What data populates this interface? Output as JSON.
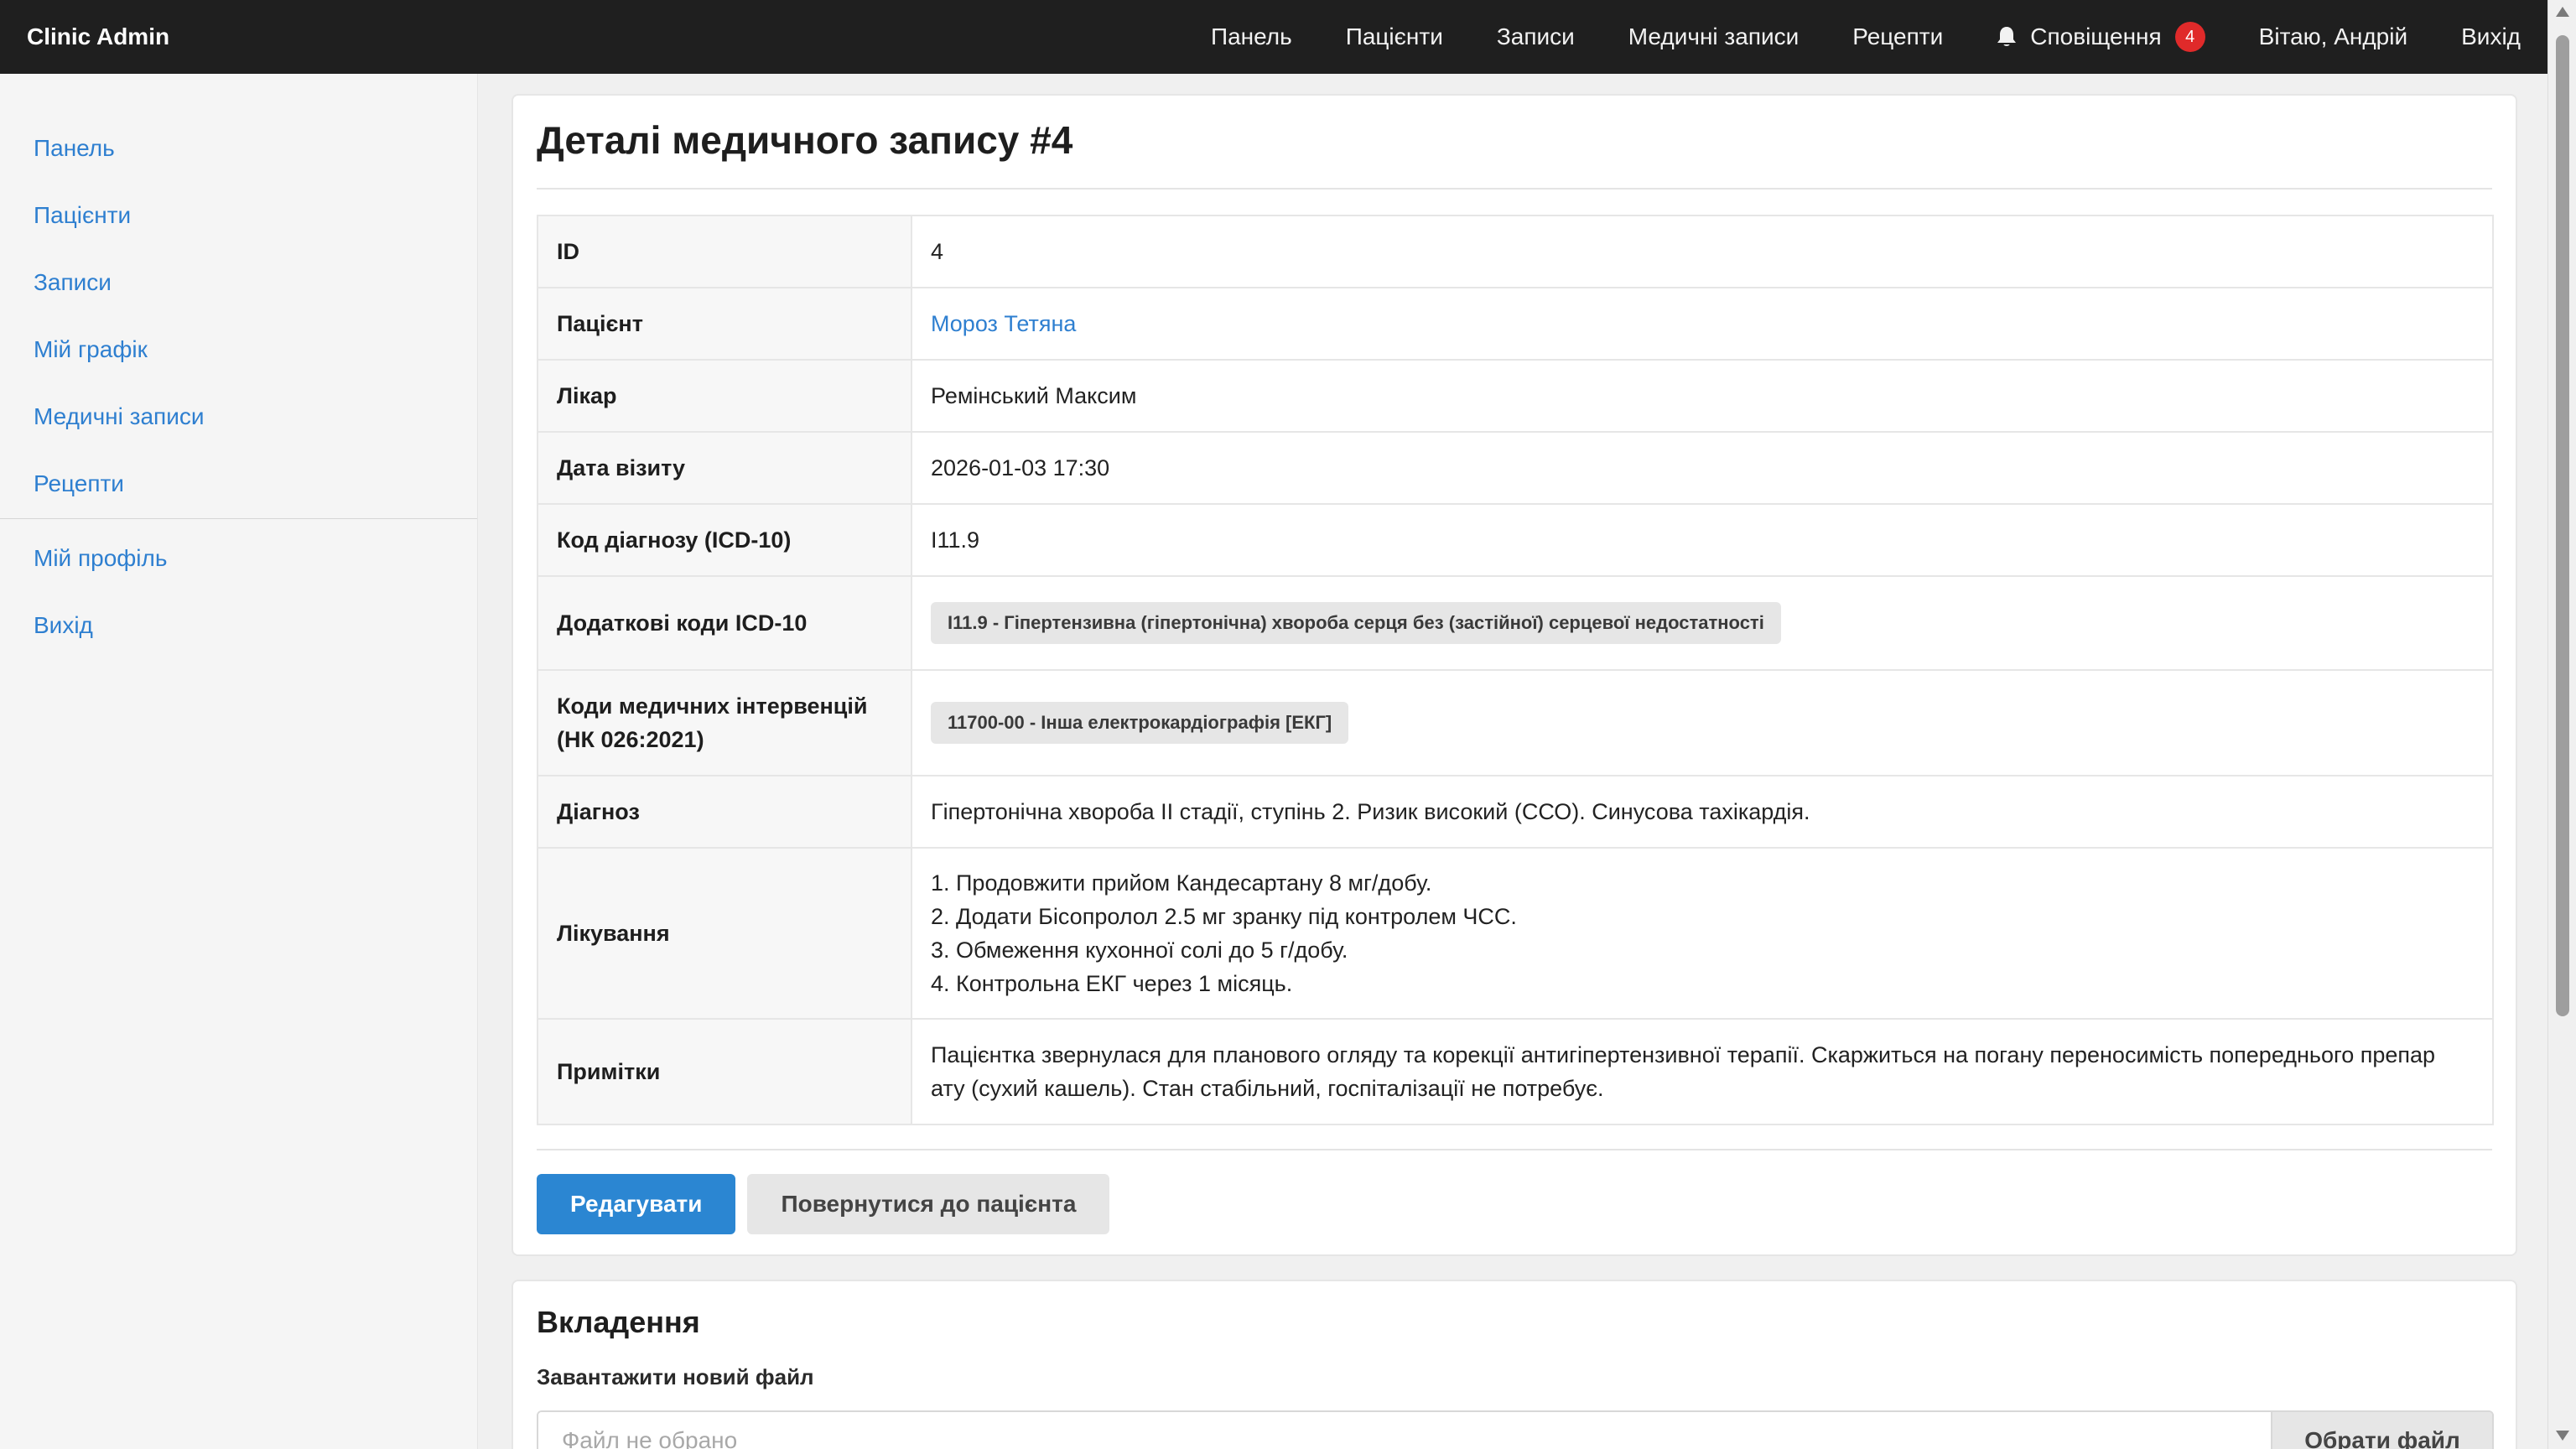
{
  "app": {
    "brand": "Clinic Admin"
  },
  "topnav": {
    "items": [
      "Панель",
      "Пацієнти",
      "Записи",
      "Медичні записи",
      "Рецепти"
    ],
    "notifications_label": "Сповіщення",
    "notifications_count": "4",
    "greeting": "Вітаю, Андрій",
    "logout": "Вихід"
  },
  "sidebar": {
    "items": [
      "Панель",
      "Пацієнти",
      "Записи",
      "Мій графік",
      "Медичні записи",
      "Рецепти"
    ],
    "profile": "Мій профіль",
    "logout": "Вихід"
  },
  "record": {
    "title": "Деталі медичного запису #4",
    "labels": {
      "id": "ID",
      "patient": "Пацієнт",
      "doctor": "Лікар",
      "visit_date": "Дата візиту",
      "diagnosis_code": "Код діагнозу (ICD-10)",
      "extra_codes": "Додаткові коди ICD-10",
      "interventions_1": "Коди медичних інтервенцій",
      "interventions_2": "(НК 026:2021)",
      "diagnosis": "Діагноз",
      "treatment": "Лікування",
      "notes": "Примітки"
    },
    "values": {
      "id": "4",
      "patient": "Мороз Тетяна",
      "doctor": "Ремінський Максим",
      "visit_date": "2026-01-03 17:30",
      "diagnosis_code": "I11.9",
      "extra_codes": [
        "I11.9 - Гіпертензивна (гіпертонічна) хвороба серця без (застійної) серцевої недостатності"
      ],
      "interventions": [
        "11700-00 - Інша електрокардіографія [ЕКГ]"
      ],
      "diagnosis": "Гіпертонічна хвороба II стадії, ступінь 2. Ризик високий (ССО). Синусова тахікардія.",
      "treatment": [
        "1. Продовжити прийом Кандесартану 8 мг/добу.",
        "2. Додати Бісопролол 2.5 мг зранку під контролем ЧСС.",
        "3. Обмеження кухонної солі до 5 г/добу.",
        "4. Контрольна ЕКГ через 1 місяць."
      ],
      "notes": [
        "Пацієнтка звернулася для планового огляду та корекції антигіпертензивної терапії. Скаржиться на погану переносимість попереднього препар",
        "ату (сухий кашель). Стан стабільний, госпіталізації не потребує."
      ]
    },
    "actions": {
      "edit": "Редагувати",
      "back": "Повернутися до пацієнта"
    }
  },
  "attachments": {
    "title": "Вкладення",
    "upload_label": "Завантажити новий файл",
    "file_placeholder": "Файл не обрано",
    "choose_button": "Обрати файл"
  },
  "colors": {
    "navbar": "#1f1f1f",
    "link": "#2e7fd0",
    "primary_button": "#2b86d2",
    "badge": "#e02a2a"
  }
}
